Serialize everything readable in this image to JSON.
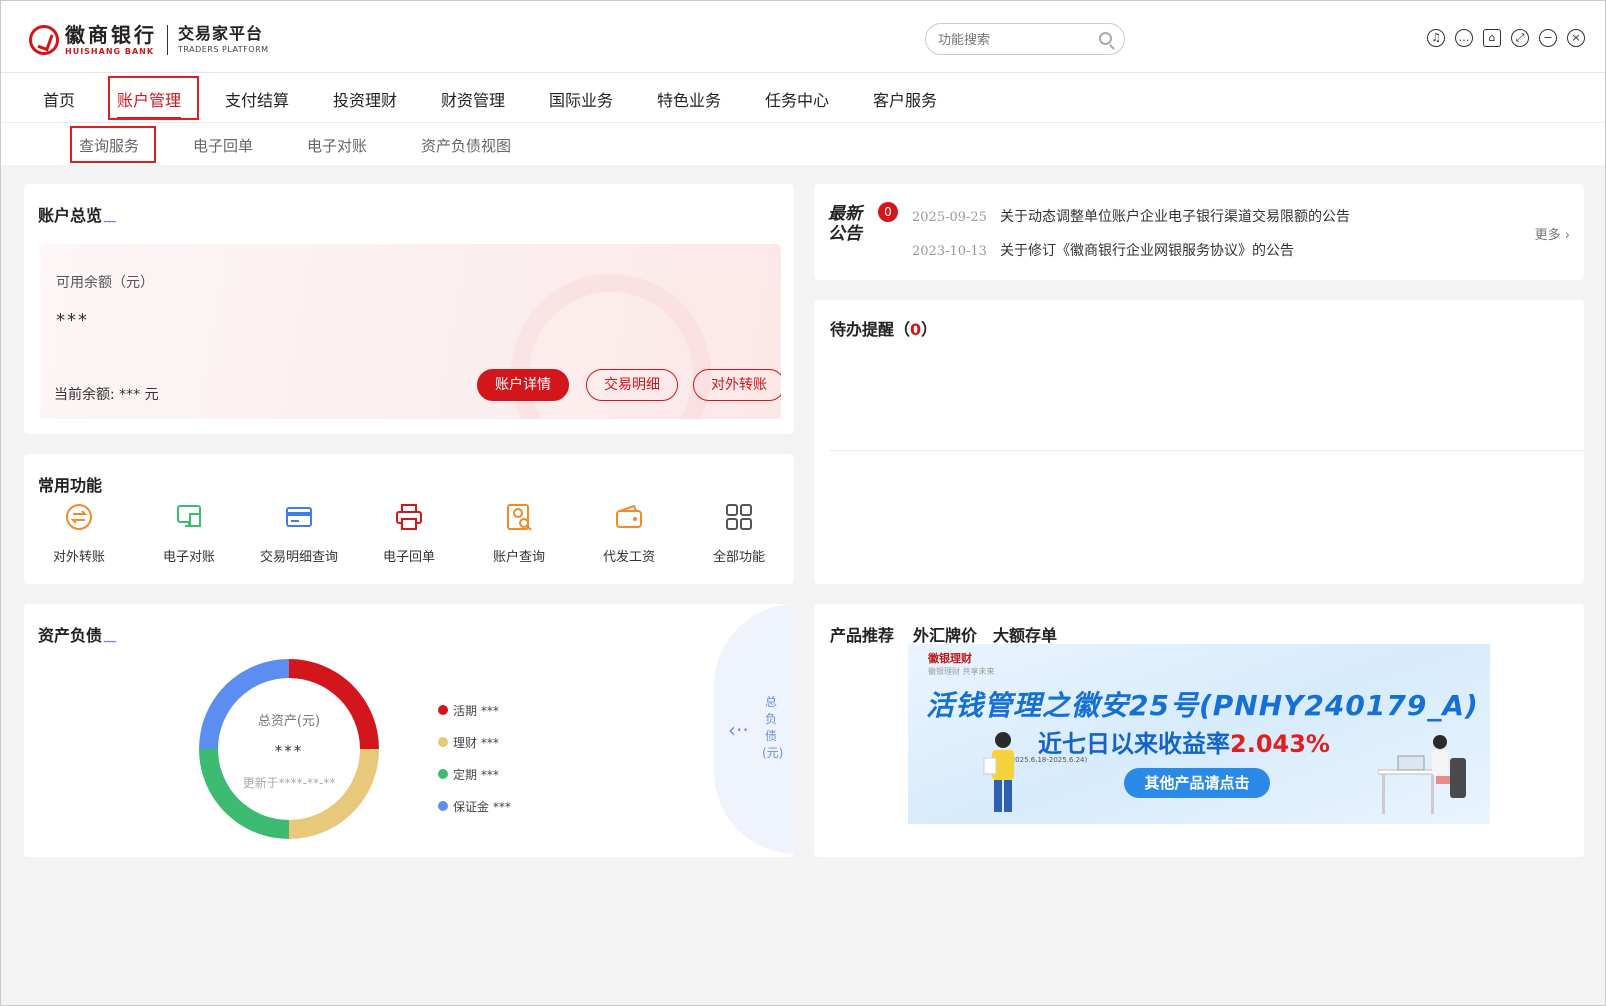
{
  "brand": {
    "name_cn": "徽商银行",
    "name_en": "HUISHANG BANK",
    "platform_cn": "交易家平台",
    "platform_en": "TRADERS PLATFORM"
  },
  "search": {
    "placeholder": "功能搜索"
  },
  "window_controls": [
    "headset-icon",
    "more-icon",
    "shirt-icon",
    "expand-icon",
    "minimize-icon",
    "close-icon"
  ],
  "nav": [
    {
      "label": "首页"
    },
    {
      "label": "账户管理"
    },
    {
      "label": "支付结算"
    },
    {
      "label": "投资理财"
    },
    {
      "label": "财资管理"
    },
    {
      "label": "国际业务"
    },
    {
      "label": "特色业务"
    },
    {
      "label": "任务中心"
    },
    {
      "label": "客户服务"
    }
  ],
  "subnav": [
    {
      "label": "查询服务"
    },
    {
      "label": "电子回单"
    },
    {
      "label": "电子对账"
    },
    {
      "label": "资产负债视图"
    }
  ],
  "account": {
    "title": "账户总览",
    "available_label": "可用余额（元）",
    "available_value": "***",
    "current_balance": "当前余额: *** 元",
    "buttons": {
      "detail": "账户详情",
      "transactions": "交易明细",
      "transfer": "对外转账"
    }
  },
  "functions": {
    "title": "常用功能",
    "items": [
      {
        "label": "对外转账",
        "icon": "transfer-icon"
      },
      {
        "label": "电子对账",
        "icon": "reconcile-icon"
      },
      {
        "label": "交易明细查询",
        "icon": "card-query-icon"
      },
      {
        "label": "电子回单",
        "icon": "printer-icon"
      },
      {
        "label": "账户查询",
        "icon": "account-search-icon"
      },
      {
        "label": "代发工资",
        "icon": "wallet-icon"
      },
      {
        "label": "全部功能",
        "icon": "grid-icon"
      }
    ]
  },
  "notices": {
    "badge_line1": "最新",
    "badge_line2": "公告",
    "unread": "0",
    "items": [
      {
        "date": "2025-09-25",
        "title": "关于动态调整单位账户企业电子银行渠道交易限额的公告"
      },
      {
        "date": "2023-10-13",
        "title": "关于修订《徽商银行企业网银服务协议》的公告"
      }
    ],
    "more": "更多"
  },
  "todo": {
    "title": "待办提醒（",
    "count": "0",
    "close": "）"
  },
  "assets": {
    "title": "资产负债",
    "center_label": "总资产(元)",
    "center_value": "***",
    "updated": "更新于****-**-**",
    "legend": [
      {
        "label": "活期 ***",
        "color": "#d3161b"
      },
      {
        "label": "理财 ***",
        "color": "#e8c87a"
      },
      {
        "label": "定期 ***",
        "color": "#3dbb72"
      },
      {
        "label": "保证金 ***",
        "color": "#5b8ef0"
      }
    ],
    "liability_label": "总负债(元)"
  },
  "products": {
    "tabs": [
      "产品推荐",
      "外汇牌价",
      "大额存单"
    ],
    "banner": {
      "brand": "徽银理财",
      "brand_sub": "徽银理财 共享未来",
      "headline": "活钱管理之徽安25号(PNHY240179_A)",
      "subline_prefix": "近七日以来收益率",
      "rate": "2.043%",
      "note": "(2025.6.18-2025.6.24)",
      "button": "其他产品请点击"
    }
  }
}
